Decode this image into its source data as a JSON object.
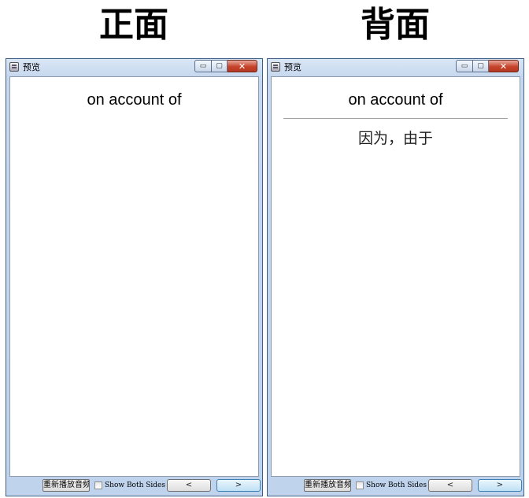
{
  "headings": {
    "front": "正面",
    "back": "背面"
  },
  "windows": [
    {
      "id": "front",
      "title": "预览",
      "caption": {
        "minimize": "▭",
        "maximize": "▢",
        "close": "✕"
      },
      "card": {
        "question": "on account of",
        "answer": ""
      },
      "footer": {
        "replay_label": "重新播放音频",
        "show_both_sides_label": "Show Both Sides",
        "show_both_sides_checked": false,
        "prev_label": "<",
        "next_label": ">"
      }
    },
    {
      "id": "back",
      "title": "预览",
      "caption": {
        "minimize": "▭",
        "maximize": "▢",
        "close": "✕"
      },
      "card": {
        "question": "on account of",
        "answer": "因为，由于"
      },
      "footer": {
        "replay_label": "重新播放音频",
        "show_both_sides_label": "Show Both Sides",
        "show_both_sides_checked": false,
        "prev_label": "<",
        "next_label": ">"
      }
    }
  ]
}
